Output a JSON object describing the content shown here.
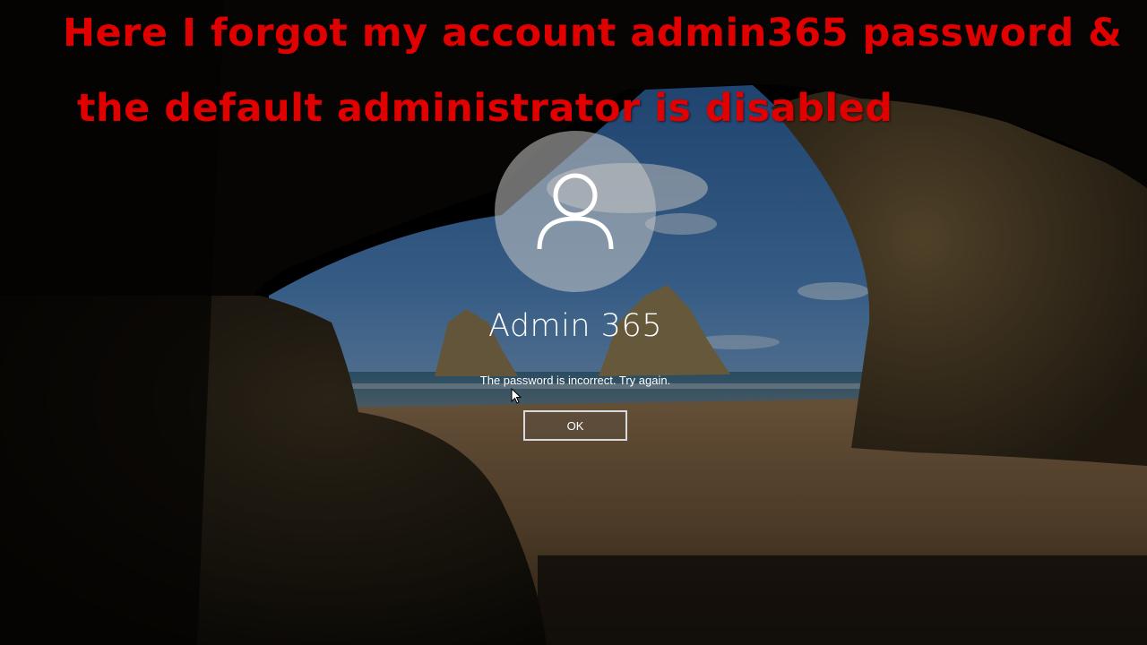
{
  "caption": {
    "line1": "Here I forgot my account admin365 password &",
    "line2": "the default administrator is disabled",
    "color": "#e00000"
  },
  "login": {
    "avatar_icon": "user-icon",
    "username": "Admin 365",
    "message": "The password is incorrect. Try again.",
    "ok_label": "OK"
  },
  "background": {
    "description_icon": "cave-beach-wallpaper",
    "sky_color": "#3d6fa8",
    "sand_color": "#8a6a48",
    "rock_color": "#5a4a30"
  }
}
